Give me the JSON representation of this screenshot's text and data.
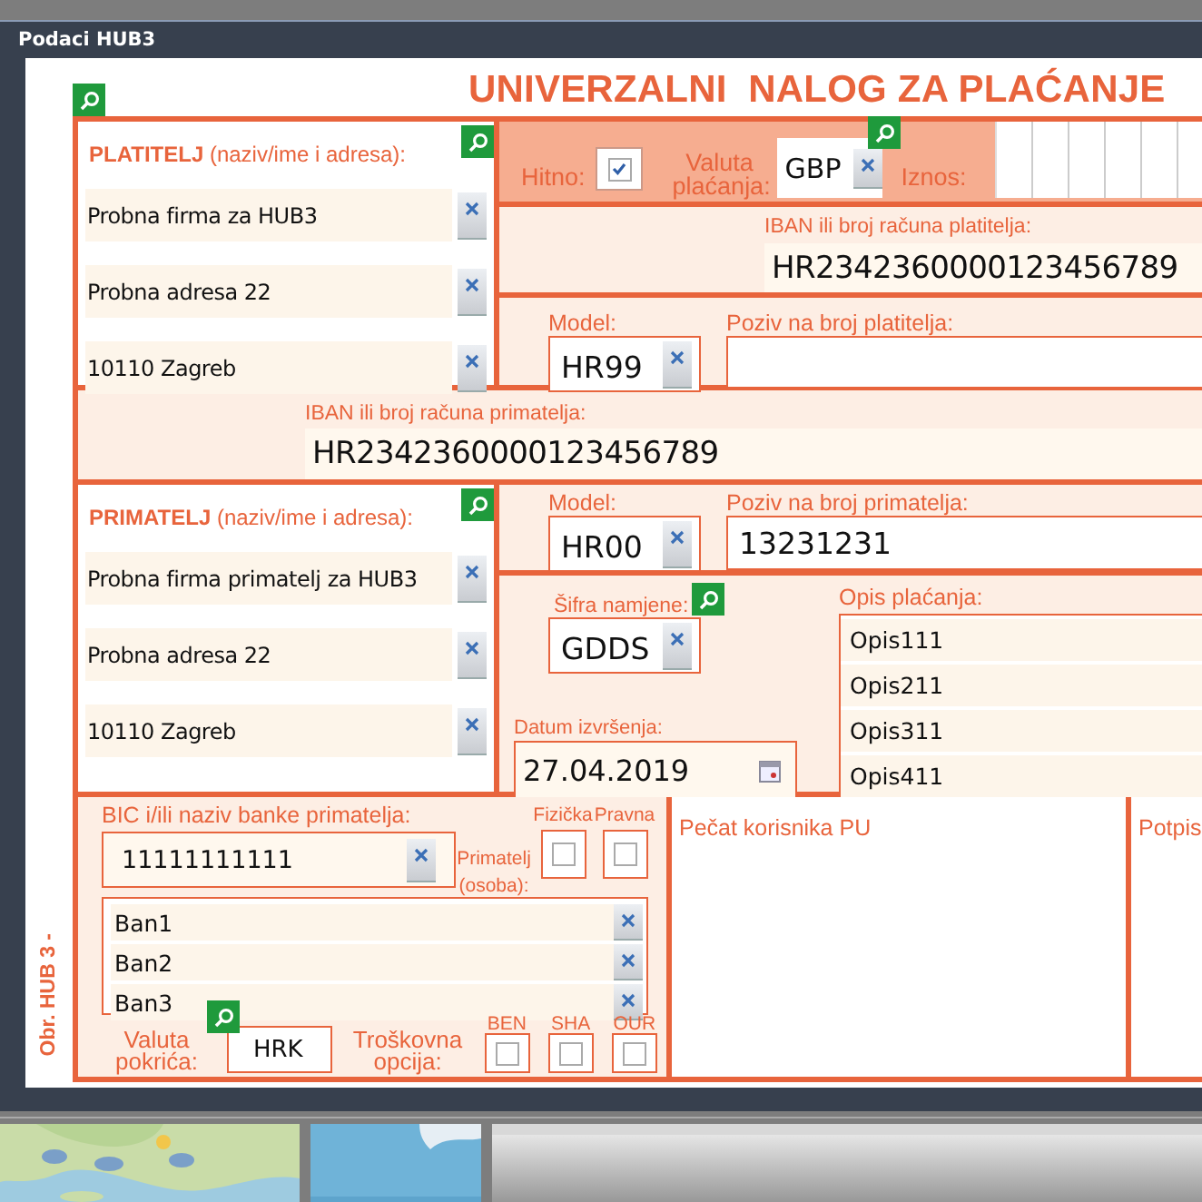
{
  "window": {
    "title": "Podaci HUB3"
  },
  "form": {
    "title": "UNIVERZALNI  NALOG ZA PLAĆANJE",
    "form_code": "Obr. HUB 3 -",
    "payer": {
      "label": "**PLATITELJ** (naziv/ime i adresa):",
      "lines": [
        "Probna firma za HUB3",
        "Probna adresa 22",
        "10110 Zagreb"
      ]
    },
    "urgent": {
      "label": "Hitno:",
      "checked": true
    },
    "currency": {
      "label": "Valuta plaćanja:",
      "value": "GBP"
    },
    "amount": {
      "label": "Iznos:"
    },
    "payer_iban": {
      "label": "IBAN ili broj računa platitelja:",
      "value": "HR2342360000123456789"
    },
    "payer_model": {
      "label": "Model:",
      "value": "HR99"
    },
    "payer_reference": {
      "label": "Poziv na broj platitelja:"
    },
    "payee_iban": {
      "label": "IBAN ili broj računa primatelja:",
      "value": "HR2342360000123456789"
    },
    "payee": {
      "label": "**PRIMATELJ** (naziv/ime i adresa):",
      "lines": [
        "Probna firma primatelj za HUB3",
        "Probna adresa 22",
        "10110 Zagreb"
      ]
    },
    "payee_model": {
      "label": "Model:",
      "value": "HR00"
    },
    "payee_reference": {
      "label": "Poziv na broj primatelja:",
      "value": "13231231"
    },
    "purpose_code": {
      "label": "Šifra namjene:",
      "value": "GDDS"
    },
    "execution_date": {
      "label": "Datum izvršenja:",
      "value": "27.04.2019"
    },
    "description": {
      "label": "Opis plaćanja:",
      "lines": [
        "Opis111",
        "Opis211",
        "Opis311",
        "Opis411"
      ]
    },
    "bank": {
      "label": "BIC i/ili naziv banke primatelja:",
      "bic": "11111111111",
      "names": [
        "Ban1",
        "Ban2",
        "Ban3"
      ]
    },
    "payee_type": {
      "label": "Primatelj (osoba):",
      "options": [
        {
          "label": "Fizička",
          "checked": false
        },
        {
          "label": "Pravna",
          "checked": false
        }
      ]
    },
    "cover_currency": {
      "label": "Valuta pokrića:",
      "value": "HRK"
    },
    "cost_option": {
      "label": "Troškovna opcija:",
      "options": [
        {
          "label": "BEN",
          "checked": false
        },
        {
          "label": "SHA",
          "checked": false
        },
        {
          "label": "OUR",
          "checked": false
        }
      ]
    },
    "stamp": {
      "label": "Pečat korisnika PU"
    },
    "signature": {
      "label": "Potpis"
    }
  }
}
